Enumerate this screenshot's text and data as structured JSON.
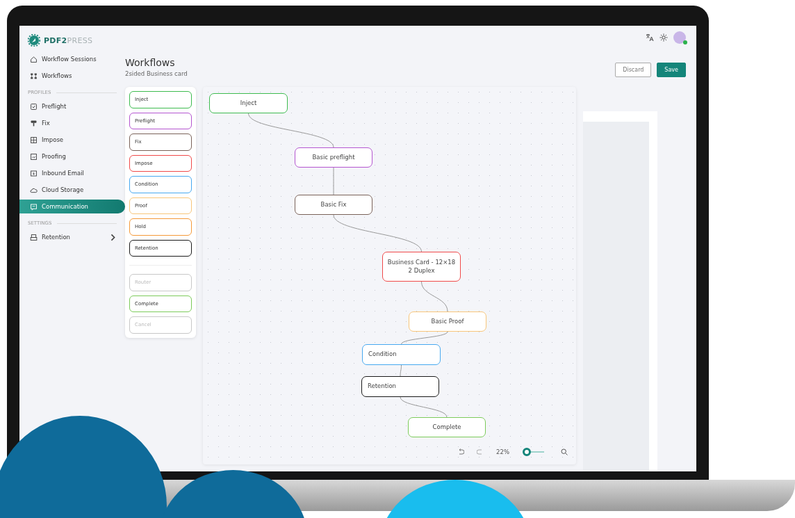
{
  "logo": "**PDF2**PRESS",
  "sidebar": {
    "items": [
      {
        "kind": "item",
        "label": "Workflow Sessions",
        "selected": false
      },
      {
        "kind": "item",
        "label": "Workflows",
        "selected": false
      },
      {
        "kind": "section",
        "label": "PROFILES"
      },
      {
        "kind": "item",
        "label": "Preflight",
        "selected": false
      },
      {
        "kind": "item",
        "label": "Fix",
        "selected": false
      },
      {
        "kind": "item",
        "label": "Impose",
        "selected": false
      },
      {
        "kind": "item",
        "label": "Proofing",
        "selected": false
      },
      {
        "kind": "item",
        "label": "Inbound Email",
        "selected": false
      },
      {
        "kind": "item",
        "label": "Cloud Storage",
        "selected": false
      },
      {
        "kind": "item",
        "label": "Communication",
        "selected": true
      },
      {
        "kind": "section",
        "label": "SETTINGS"
      },
      {
        "kind": "item",
        "label": "Retention",
        "selected": false,
        "expandable": true
      }
    ]
  },
  "header": {
    "title": "Workflows",
    "subtitle": "2sided Business card",
    "buttons": [
      {
        "label": "Discard",
        "kind": "outline"
      },
      {
        "label": "Save",
        "kind": "primary"
      }
    ]
  },
  "palette": [
    {
      "label": "Inject",
      "color": "#3dbb4f",
      "disabled": false
    },
    {
      "label": "Preflight",
      "color": "#b455d0",
      "disabled": false
    },
    {
      "label": "Fix",
      "color": "#7a6259",
      "disabled": false
    },
    {
      "label": "Impose",
      "color": "#f04a4a",
      "disabled": false
    },
    {
      "label": "Condition",
      "color": "#47a9f0",
      "disabled": false
    },
    {
      "label": "Proof",
      "color": "#f8c67a",
      "disabled": false
    },
    {
      "label": "Hold",
      "color": "#f59a3a",
      "disabled": false
    },
    {
      "label": "Retention",
      "color": "#1b1b1b",
      "disabled": false
    },
    {
      "kind": "divider"
    },
    {
      "label": "Router",
      "color": "#c8c8c8",
      "disabled": true
    },
    {
      "label": "Complete",
      "color": "#7ccb5a",
      "disabled": false
    },
    {
      "label": "Cancel",
      "color": "#c8c8c8",
      "disabled": true
    }
  ],
  "canvas": {
    "nodes": [
      {
        "label": "Inject",
        "color": "#3dbb4f",
        "kind": "centered"
      },
      {
        "label": "Basic preflight",
        "color": "#b455d0",
        "kind": "centered"
      },
      {
        "label": "Basic Fix",
        "color": "#7a6259",
        "kind": "centered"
      },
      {
        "label": "Business Card - 12×18\n2 Duplex",
        "color": "#f04a4a",
        "kind": "centered"
      },
      {
        "label": "Basic Proof",
        "color": "#f8c67a",
        "kind": "centered"
      },
      {
        "label": "Condition",
        "color": "#47a9f0",
        "kind": "leading"
      },
      {
        "label": "Retention",
        "color": "#1b1b1b",
        "kind": "leading"
      },
      {
        "label": "Complete",
        "color": "#7ccb5a",
        "kind": "centered"
      }
    ],
    "zoom": {
      "reading": "22%",
      "level": 0.05
    }
  }
}
